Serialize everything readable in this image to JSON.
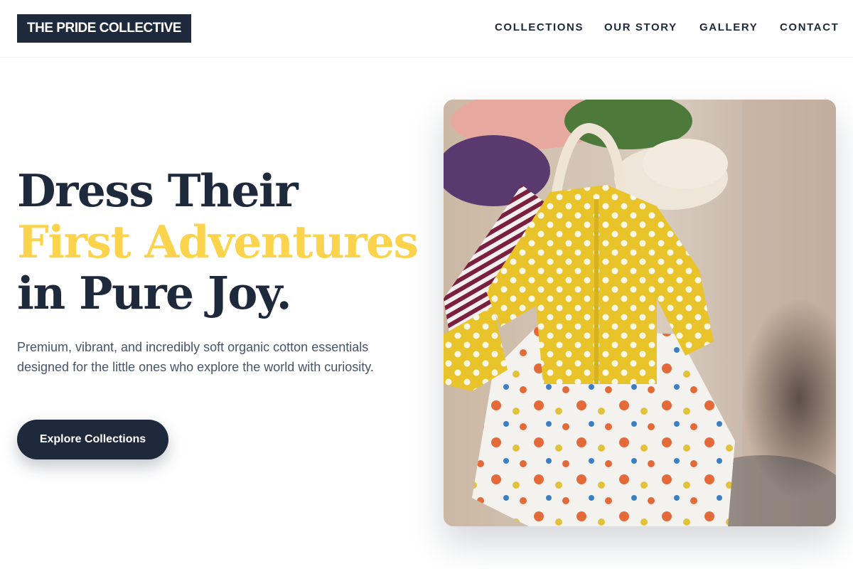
{
  "brand": {
    "name": "THE PRIDE COLLECTIVE"
  },
  "nav": {
    "items": [
      {
        "label": "COLLECTIONS"
      },
      {
        "label": "OUR STORY"
      },
      {
        "label": "GALLERY"
      },
      {
        "label": "CONTACT"
      }
    ]
  },
  "hero": {
    "headline_line1": "Dress Their",
    "headline_line2": "First Adventures",
    "headline_line3": "in Pure Joy.",
    "description": "Premium, vibrant, and incredibly soft organic cotton essentials designed for the little ones who explore the world with curiosity.",
    "cta_label": "Explore Collections",
    "image_alt": "Yellow polka-dot baby cardigan over a printed dress on a hanger"
  },
  "colors": {
    "primary": "#1e293b",
    "accent": "#fcd34d",
    "body_text": "#475569",
    "background": "#ffffff"
  }
}
